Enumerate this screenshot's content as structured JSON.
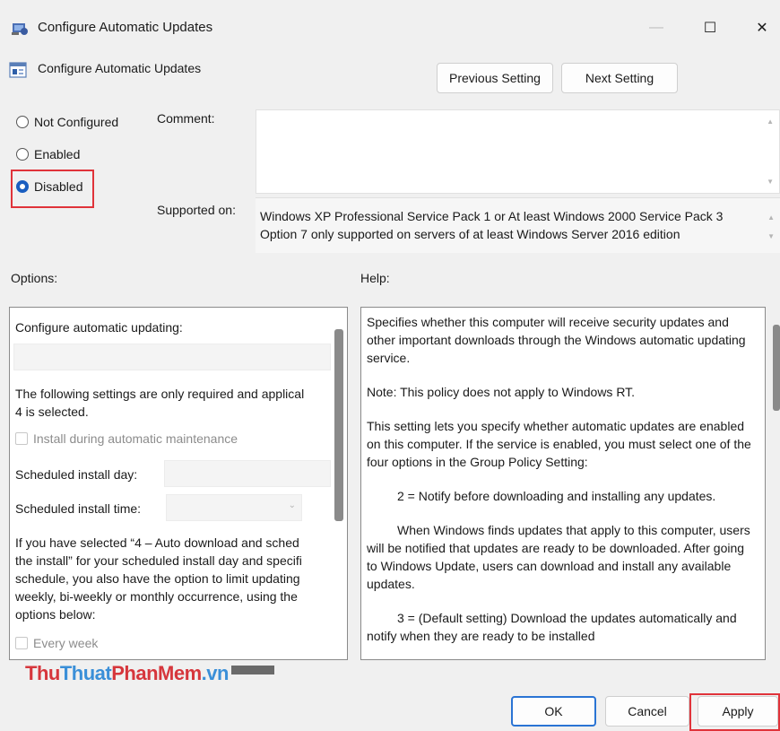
{
  "window": {
    "title": "Configure Automatic Updates",
    "minimize": "—",
    "maximize": "☐",
    "close": "✕"
  },
  "header": {
    "policy_name": "Configure Automatic Updates",
    "previous_label": "Previous Setting",
    "next_label": "Next Setting"
  },
  "state": {
    "options": [
      "Not Configured",
      "Enabled",
      "Disabled"
    ],
    "selected": "Disabled"
  },
  "comment": {
    "label": "Comment:",
    "value": ""
  },
  "supported": {
    "label": "Supported on:",
    "line1": "Windows XP Professional Service Pack 1 or At least Windows 2000 Service Pack 3",
    "line2": "Option 7 only supported on servers of at least Windows Server 2016 edition"
  },
  "options_panel": {
    "label": "Options:",
    "configure_label": "Configure automatic updating:",
    "note_line1": "The following settings are only required and applical",
    "note_line2": "4 is selected.",
    "install_maintenance": "Install during automatic maintenance",
    "install_day_label": "Scheduled install day:",
    "install_time_label": "Scheduled install time:",
    "para_line1": "If you have selected “4 – Auto download and sched",
    "para_line2": "the install” for your scheduled install day and specifi",
    "para_line3": "schedule, you also have the option to limit updating",
    "para_line4": "weekly, bi-weekly or monthly occurrence, using the",
    "para_line5": "options below:",
    "every_week": "Every week"
  },
  "help_panel": {
    "label": "Help:",
    "p1": "Specifies whether this computer will receive security updates and other important downloads through the Windows automatic updating service.",
    "p2": "Note: This policy does not apply to Windows RT.",
    "p3": "This setting lets you specify whether automatic updates are enabled on this computer. If the service is enabled, you must select one of the four options in the Group Policy Setting:",
    "p4": "2 = Notify before downloading and installing any updates.",
    "p5": "When Windows finds updates that apply to this computer, users will be notified that updates are ready to be downloaded. After going to Windows Update, users can download and install any available updates.",
    "p6": "3 = (Default setting) Download the updates automatically and notify when they are ready to be installed"
  },
  "watermark": {
    "part1": "Thu",
    "part2": "Thuat",
    "part3": "PhanMem",
    "part4": ".vn"
  },
  "footer": {
    "ok_label": "OK",
    "cancel_label": "Cancel",
    "apply_label": "Apply"
  }
}
